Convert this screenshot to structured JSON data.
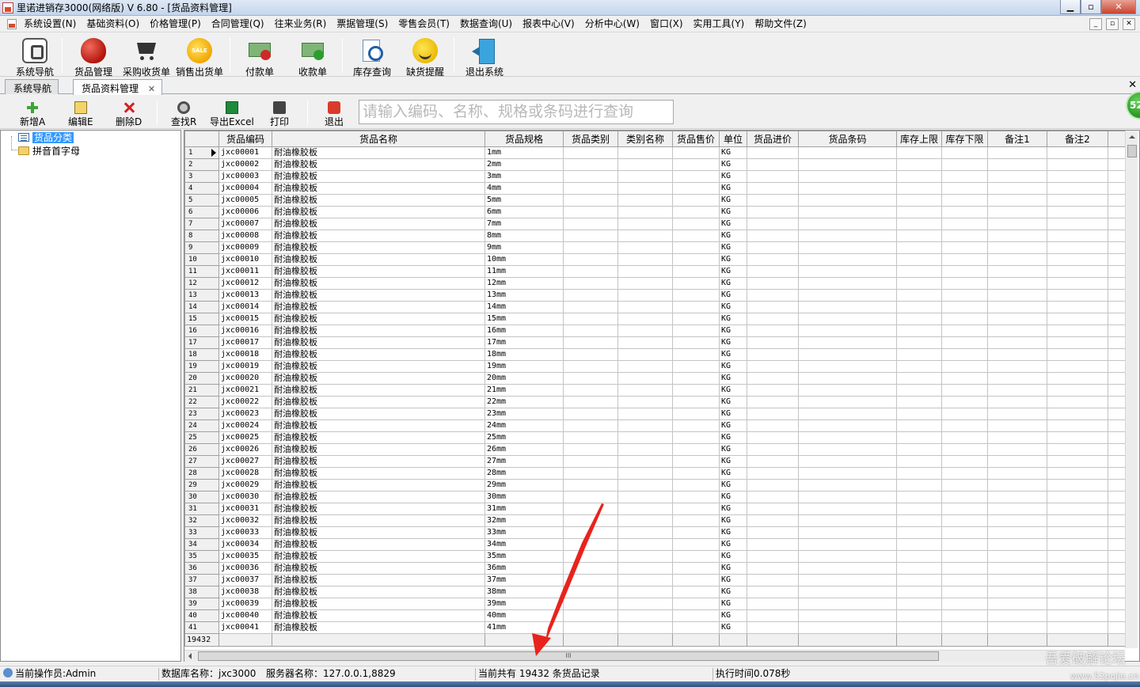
{
  "window": {
    "title": "里诺进销存3000(网络版) V 6.80 - [货品资料管理]",
    "buttons": [
      "▁",
      "▫",
      "✕"
    ]
  },
  "menu": {
    "items": [
      "系统设置(N)",
      "基础资料(O)",
      "价格管理(P)",
      "合同管理(Q)",
      "往来业务(R)",
      "票据管理(S)",
      "零售会员(T)",
      "数据查询(U)",
      "报表中心(V)",
      "分析中心(W)",
      "窗口(X)",
      "实用工具(Y)",
      "帮助文件(Z)"
    ],
    "mdi_buttons": [
      "_",
      "▫",
      "✕"
    ]
  },
  "toolbar": {
    "nav": "系统导航",
    "goods": "货品管理",
    "purchase": "采购收货单",
    "sales": "销售出货单",
    "sale_icon_text": "SALE",
    "payment": "付款单",
    "receipt": "收款单",
    "stock_query": "库存查询",
    "shortage": "缺货提醒",
    "exit": "退出系统"
  },
  "tabs": {
    "nav": "系统导航",
    "goods": "货品资料管理",
    "close": "✕",
    "close_all": "✕"
  },
  "subtoolbar": {
    "add": "新增A",
    "edit": "编辑E",
    "delete": "删除D",
    "find": "查找R",
    "export": "导出Excel",
    "print": "打印",
    "exit": "退出",
    "search_placeholder": "请输入编码、名称、规格或条码进行查询"
  },
  "badge": "52",
  "tree": {
    "root": "货品分类",
    "child": "拼音首字母"
  },
  "grid": {
    "columns": [
      "货品编码",
      "货品名称",
      "货品规格",
      "货品类别",
      "类别名称",
      "货品售价",
      "单位",
      "货品进价",
      "货品条码",
      "库存上限",
      "库存下限",
      "备注1",
      "备注2"
    ],
    "product_name": "耐油橡胶板",
    "unit": "KG",
    "rows": [
      [
        "1",
        "jxc00001",
        "1mm"
      ],
      [
        "2",
        "jxc00002",
        "2mm"
      ],
      [
        "3",
        "jxc00003",
        "3mm"
      ],
      [
        "4",
        "jxc00004",
        "4mm"
      ],
      [
        "5",
        "jxc00005",
        "5mm"
      ],
      [
        "6",
        "jxc00006",
        "6mm"
      ],
      [
        "7",
        "jxc00007",
        "7mm"
      ],
      [
        "8",
        "jxc00008",
        "8mm"
      ],
      [
        "9",
        "jxc00009",
        "9mm"
      ],
      [
        "10",
        "jxc00010",
        "10mm"
      ],
      [
        "11",
        "jxc00011",
        "11mm"
      ],
      [
        "12",
        "jxc00012",
        "12mm"
      ],
      [
        "13",
        "jxc00013",
        "13mm"
      ],
      [
        "14",
        "jxc00014",
        "14mm"
      ],
      [
        "15",
        "jxc00015",
        "15mm"
      ],
      [
        "16",
        "jxc00016",
        "16mm"
      ],
      [
        "17",
        "jxc00017",
        "17mm"
      ],
      [
        "18",
        "jxc00018",
        "18mm"
      ],
      [
        "19",
        "jxc00019",
        "19mm"
      ],
      [
        "20",
        "jxc00020",
        "20mm"
      ],
      [
        "21",
        "jxc00021",
        "21mm"
      ],
      [
        "22",
        "jxc00022",
        "22mm"
      ],
      [
        "23",
        "jxc00023",
        "23mm"
      ],
      [
        "24",
        "jxc00024",
        "24mm"
      ],
      [
        "25",
        "jxc00025",
        "25mm"
      ],
      [
        "26",
        "jxc00026",
        "26mm"
      ],
      [
        "27",
        "jxc00027",
        "27mm"
      ],
      [
        "28",
        "jxc00028",
        "28mm"
      ],
      [
        "29",
        "jxc00029",
        "29mm"
      ],
      [
        "30",
        "jxc00030",
        "30mm"
      ],
      [
        "31",
        "jxc00031",
        "31mm"
      ],
      [
        "32",
        "jxc00032",
        "32mm"
      ],
      [
        "33",
        "jxc00033",
        "33mm"
      ],
      [
        "34",
        "jxc00034",
        "34mm"
      ],
      [
        "35",
        "jxc00035",
        "35mm"
      ],
      [
        "36",
        "jxc00036",
        "36mm"
      ],
      [
        "37",
        "jxc00037",
        "37mm"
      ],
      [
        "38",
        "jxc00038",
        "38mm"
      ],
      [
        "39",
        "jxc00039",
        "39mm"
      ],
      [
        "40",
        "jxc00040",
        "40mm"
      ],
      [
        "41",
        "jxc00041",
        "41mm"
      ]
    ],
    "footer_count": "19432",
    "hscroll_grip": "III"
  },
  "status": {
    "operator": "当前操作员:Admin",
    "database": "数据库名称：jxc3000",
    "server": "服务器名称：127.0.0.1,8829",
    "records": "当前共有 19432 条货品记录",
    "exec_time": "执行时间0.078秒"
  },
  "watermark": {
    "text": "吾爱破解论坛",
    "url": "www.52pojie.cn"
  },
  "colors": {
    "selection": "#3399ff",
    "annotation_arrow": "#e8231d"
  }
}
